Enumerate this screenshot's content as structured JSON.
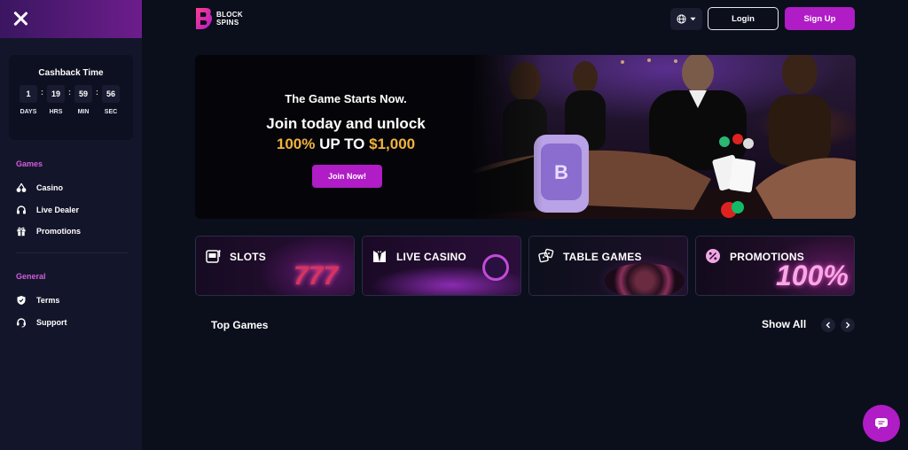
{
  "sidebar": {
    "cashback": {
      "title": "Cashback Time",
      "units": [
        {
          "value": "1",
          "label": "DAYS"
        },
        {
          "value": "19",
          "label": "HRS"
        },
        {
          "value": "59",
          "label": "MIN"
        },
        {
          "value": "56",
          "label": "SEC"
        }
      ]
    },
    "games_heading": "Games",
    "games_items": [
      {
        "label": "Casino",
        "icon": "cherries-icon"
      },
      {
        "label": "Live Dealer",
        "icon": "headset-icon"
      },
      {
        "label": "Promotions",
        "icon": "gift-icon"
      }
    ],
    "general_heading": "General",
    "general_items": [
      {
        "label": "Terms",
        "icon": "shield-icon"
      },
      {
        "label": "Support",
        "icon": "support-icon"
      }
    ]
  },
  "header": {
    "logo_line1": "BLOCK",
    "logo_line2": "SPINS",
    "login_label": "Login",
    "signup_label": "Sign Up"
  },
  "banner": {
    "subtitle": "The Game Starts Now.",
    "line1": "Join today and unlock",
    "line2_a": "100%",
    "line2_b": " UP TO ",
    "line2_c": "$1,000",
    "cta": "Join Now!"
  },
  "categories": [
    {
      "label": "SLOTS",
      "icon": "slot-machine-icon",
      "deco": "777"
    },
    {
      "label": "LIVE CASINO",
      "icon": "tuxedo-icon",
      "deco": ""
    },
    {
      "label": "TABLE GAMES",
      "icon": "dice-icon",
      "deco": ""
    },
    {
      "label": "PROMOTIONS",
      "icon": "percent-badge-icon",
      "deco": "100%"
    }
  ],
  "top_games": {
    "title": "Top Games",
    "show_all": "Show All"
  },
  "colors": {
    "accent": "#b01cc6",
    "gold": "#f2b33d",
    "section_heading": "#d45cdc",
    "background": "#0b0e1b",
    "sidebar": "#13162a"
  }
}
